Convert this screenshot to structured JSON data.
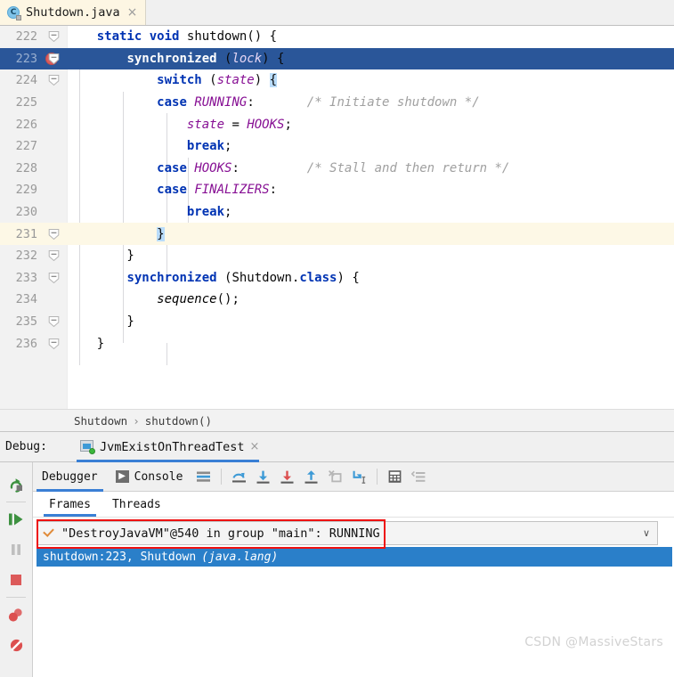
{
  "editor_tab": {
    "filename": "Shutdown.java",
    "icon": "java-class-icon",
    "icon_letter": "C",
    "close": "×"
  },
  "code": {
    "lines": [
      {
        "num": "222",
        "fold": "collapse",
        "breakpoint": false,
        "exec": false,
        "caret": false,
        "text": "    static void shutdown() {"
      },
      {
        "num": "223",
        "fold": "collapse",
        "breakpoint": true,
        "exec": true,
        "caret": false,
        "text": "        synchronized (lock) {"
      },
      {
        "num": "224",
        "fold": "collapse",
        "breakpoint": false,
        "exec": false,
        "caret": false,
        "text": "            switch (state) {"
      },
      {
        "num": "225",
        "fold": "none",
        "breakpoint": false,
        "exec": false,
        "caret": false,
        "text": "            case RUNNING:       /* Initiate shutdown */"
      },
      {
        "num": "226",
        "fold": "none",
        "breakpoint": false,
        "exec": false,
        "caret": false,
        "text": "                state = HOOKS;"
      },
      {
        "num": "227",
        "fold": "none",
        "breakpoint": false,
        "exec": false,
        "caret": false,
        "text": "                break;"
      },
      {
        "num": "228",
        "fold": "none",
        "breakpoint": false,
        "exec": false,
        "caret": false,
        "text": "            case HOOKS:         /* Stall and then return */"
      },
      {
        "num": "229",
        "fold": "none",
        "breakpoint": false,
        "exec": false,
        "caret": false,
        "text": "            case FINALIZERS:"
      },
      {
        "num": "230",
        "fold": "none",
        "breakpoint": false,
        "exec": false,
        "caret": false,
        "text": "                break;"
      },
      {
        "num": "231",
        "fold": "collapse",
        "breakpoint": false,
        "exec": false,
        "caret": true,
        "text": "            }"
      },
      {
        "num": "232",
        "fold": "collapse",
        "breakpoint": false,
        "exec": false,
        "caret": false,
        "text": "        }"
      },
      {
        "num": "233",
        "fold": "collapse",
        "breakpoint": false,
        "exec": false,
        "caret": false,
        "text": "        synchronized (Shutdown.class) {"
      },
      {
        "num": "234",
        "fold": "none",
        "breakpoint": false,
        "exec": false,
        "caret": false,
        "text": "            sequence();"
      },
      {
        "num": "235",
        "fold": "collapse",
        "breakpoint": false,
        "exec": false,
        "caret": false,
        "text": "        }"
      },
      {
        "num": "236",
        "fold": "collapse",
        "breakpoint": false,
        "exec": false,
        "caret": false,
        "text": "    }"
      }
    ]
  },
  "breadcrumb": {
    "class": "Shutdown",
    "separator": "›",
    "method": "shutdown()"
  },
  "debug_header": {
    "label": "Debug:",
    "config_name": "JvmExistOnThreadTest",
    "config_icon": "run-configuration-icon",
    "status_dot": "running",
    "close": "×"
  },
  "sidebar": {
    "items": [
      {
        "name": "rerun-button",
        "title": "Rerun"
      },
      {
        "name": "resume-program-button",
        "title": "Resume Program"
      },
      {
        "name": "pause-program-button",
        "title": "Pause Program"
      },
      {
        "name": "stop-button",
        "title": "Stop"
      },
      {
        "name": "view-breakpoints-button",
        "title": "View Breakpoints"
      },
      {
        "name": "mute-breakpoints-button",
        "title": "Mute Breakpoints"
      }
    ]
  },
  "debug_tabs": {
    "debugger": "Debugger",
    "console": "Console",
    "console_icon": "console-icon",
    "layout_icon": "layout-settings-icon",
    "buttons": [
      {
        "name": "step-over-button",
        "icon": "step-over-icon"
      },
      {
        "name": "step-into-button",
        "icon": "step-into-icon"
      },
      {
        "name": "force-step-into-button",
        "icon": "force-step-into-icon"
      },
      {
        "name": "step-out-button",
        "icon": "step-out-icon"
      },
      {
        "name": "drop-frame-button",
        "icon": "drop-frame-icon"
      },
      {
        "name": "run-to-cursor-button",
        "icon": "run-to-cursor-icon"
      },
      {
        "name": "evaluate-expression-button",
        "icon": "calculator-icon"
      },
      {
        "name": "settings-button",
        "icon": "settings-icon"
      }
    ]
  },
  "frames_panel": {
    "tab_frames": "Frames",
    "tab_threads": "Threads",
    "thread_selector": {
      "value": "\"DestroyJavaVM\"@540 in group \"main\": RUNNING",
      "check_icon": "check-icon",
      "chevron": "∨"
    },
    "frames": [
      {
        "text": "shutdown:223, Shutdown ",
        "package": "(java.lang)"
      }
    ]
  },
  "watermark": "CSDN @MassiveStars",
  "colors": {
    "exec_line": "#2a5699",
    "caret_line": "#fdf8e6",
    "keyword": "#0033b3",
    "field": "#871094",
    "comment": "#a0a0a0",
    "accent": "#3a7fd5",
    "annotation_box": "#ee1111",
    "frame_selected": "#2a7fc9"
  }
}
